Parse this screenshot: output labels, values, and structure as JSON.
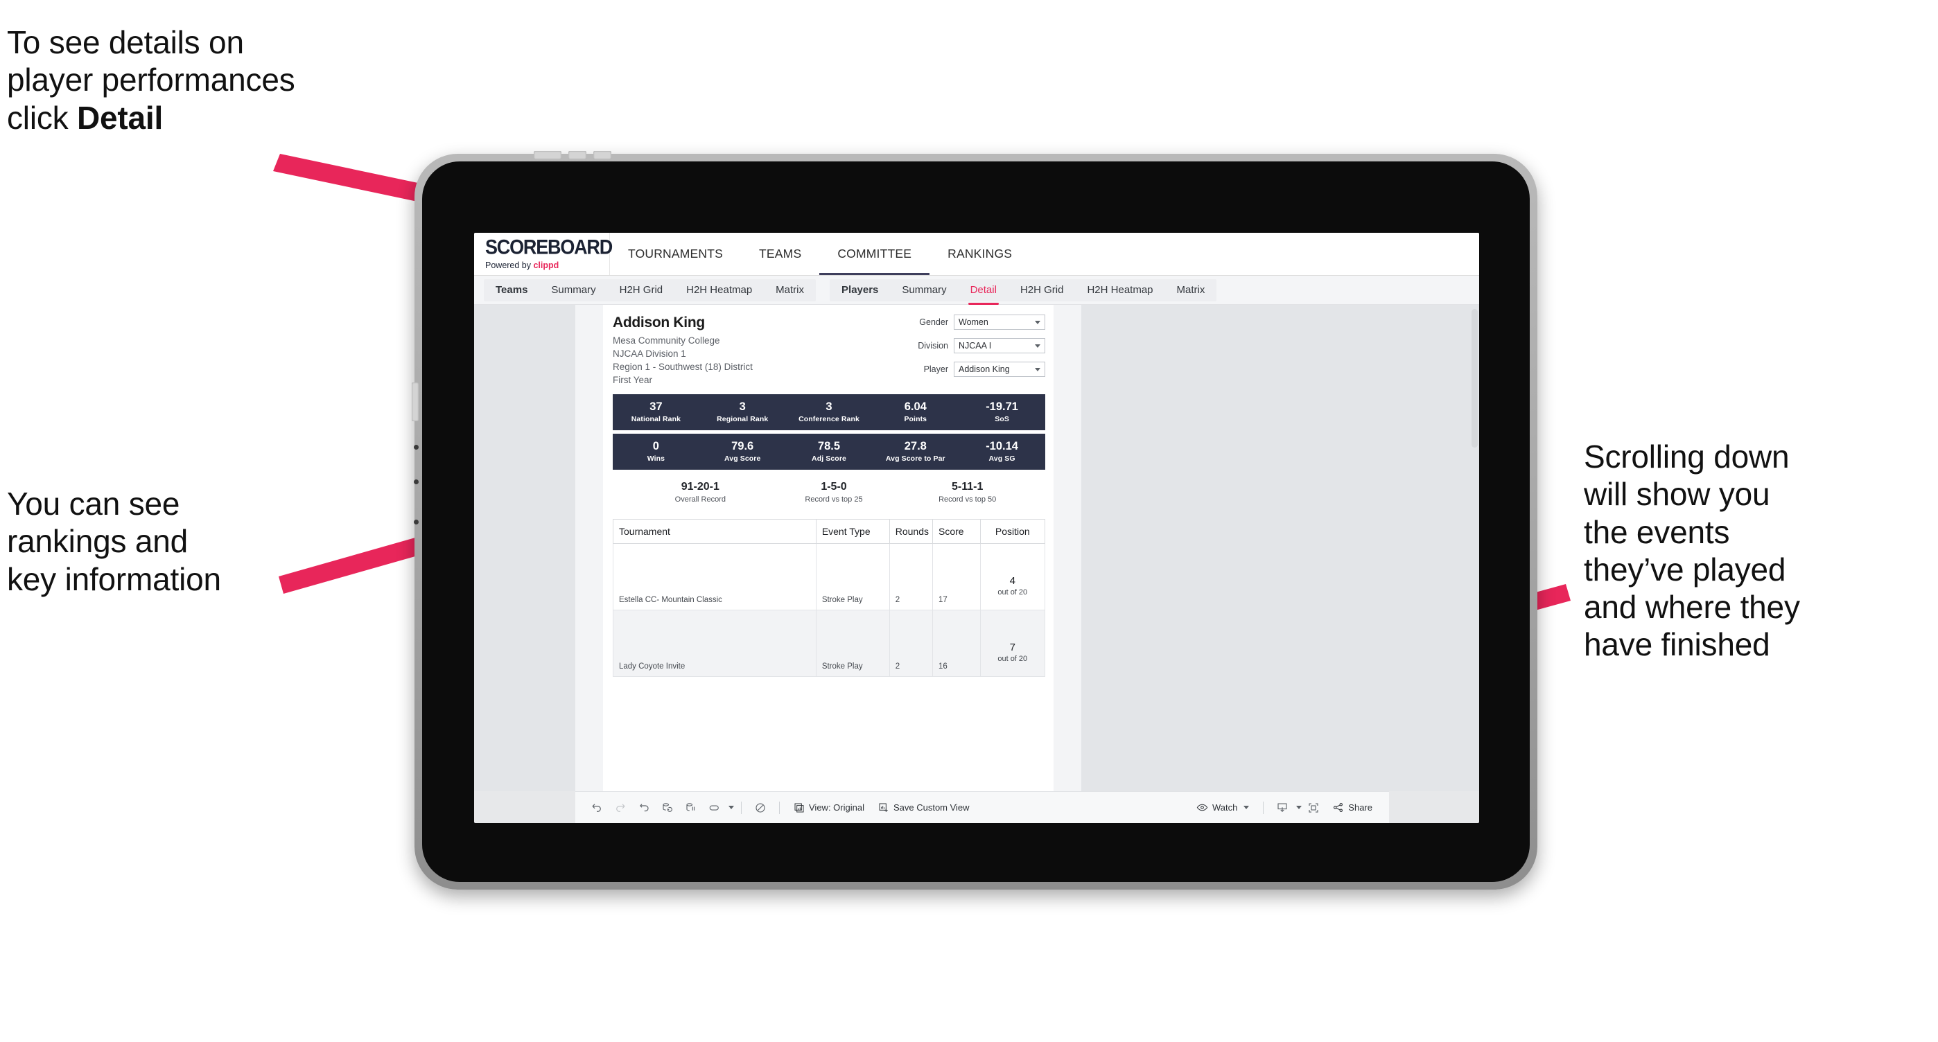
{
  "annotations": {
    "top_left": "To see details on\nplayer performances\nclick ",
    "top_left_bold": "Detail",
    "left": "You can see\nrankings and\nkey information",
    "right": "Scrolling down\nwill show you\nthe events\nthey’ve played\nand where they\nhave finished",
    "arrow_color": "#e8265a"
  },
  "app": {
    "brand": {
      "title": "SCOREBOARD",
      "powered_prefix": "Powered by ",
      "powered_name": "clippd"
    },
    "top_nav": [
      {
        "label": "TOURNAMENTS",
        "active": false
      },
      {
        "label": "TEAMS",
        "active": false
      },
      {
        "label": "COMMITTEE",
        "active": true
      },
      {
        "label": "RANKINGS",
        "active": false
      }
    ],
    "sub_nav_teams": [
      {
        "label": "Teams",
        "active": false
      },
      {
        "label": "Summary",
        "active": false
      },
      {
        "label": "H2H Grid",
        "active": false
      },
      {
        "label": "H2H Heatmap",
        "active": false
      },
      {
        "label": "Matrix",
        "active": false
      }
    ],
    "sub_nav_players": [
      {
        "label": "Players",
        "active": false
      },
      {
        "label": "Summary",
        "active": false
      },
      {
        "label": "Detail",
        "active": true
      },
      {
        "label": "H2H Grid",
        "active": false
      },
      {
        "label": "H2H Heatmap",
        "active": false
      },
      {
        "label": "Matrix",
        "active": false
      }
    ],
    "accent_color": "#e8265a",
    "statbar_color": "#2d3349"
  },
  "player": {
    "name": "Addison King",
    "school": "Mesa Community College",
    "division": "NJCAA Division 1",
    "region": "Region 1 - Southwest (18) District",
    "year": "First Year"
  },
  "selectors": [
    {
      "label": "Gender",
      "value": "Women"
    },
    {
      "label": "Division",
      "value": "NJCAA I"
    },
    {
      "label": "Player",
      "value": "Addison King"
    }
  ],
  "stats_row1": [
    {
      "value": "37",
      "label": "National Rank"
    },
    {
      "value": "3",
      "label": "Regional Rank"
    },
    {
      "value": "3",
      "label": "Conference Rank"
    },
    {
      "value": "6.04",
      "label": "Points"
    },
    {
      "value": "-19.71",
      "label": "SoS"
    }
  ],
  "stats_row2": [
    {
      "value": "0",
      "label": "Wins"
    },
    {
      "value": "79.6",
      "label": "Avg Score"
    },
    {
      "value": "78.5",
      "label": "Adj Score"
    },
    {
      "value": "27.8",
      "label": "Avg Score to Par"
    },
    {
      "value": "-10.14",
      "label": "Avg SG"
    }
  ],
  "records": [
    {
      "value": "91-20-1",
      "label": "Overall Record"
    },
    {
      "value": "1-5-0",
      "label": "Record vs top 25"
    },
    {
      "value": "5-11-1",
      "label": "Record vs top 50"
    }
  ],
  "events_table": {
    "headers": [
      "Tournament",
      "Event Type",
      "Rounds",
      "Score",
      "Position"
    ],
    "rows": [
      {
        "tournament": "Estella CC- Mountain Classic",
        "event_type": "Stroke Play",
        "rounds": "2",
        "score": "17",
        "position": "4",
        "out_of": "out of 20"
      },
      {
        "tournament": "Lady Coyote Invite",
        "event_type": "Stroke Play",
        "rounds": "2",
        "score": "16",
        "position": "7",
        "out_of": "out of 20"
      }
    ]
  },
  "toolbar": {
    "view_label": "View: Original",
    "save_label": "Save Custom View",
    "watch_label": "Watch",
    "share_label": "Share"
  }
}
